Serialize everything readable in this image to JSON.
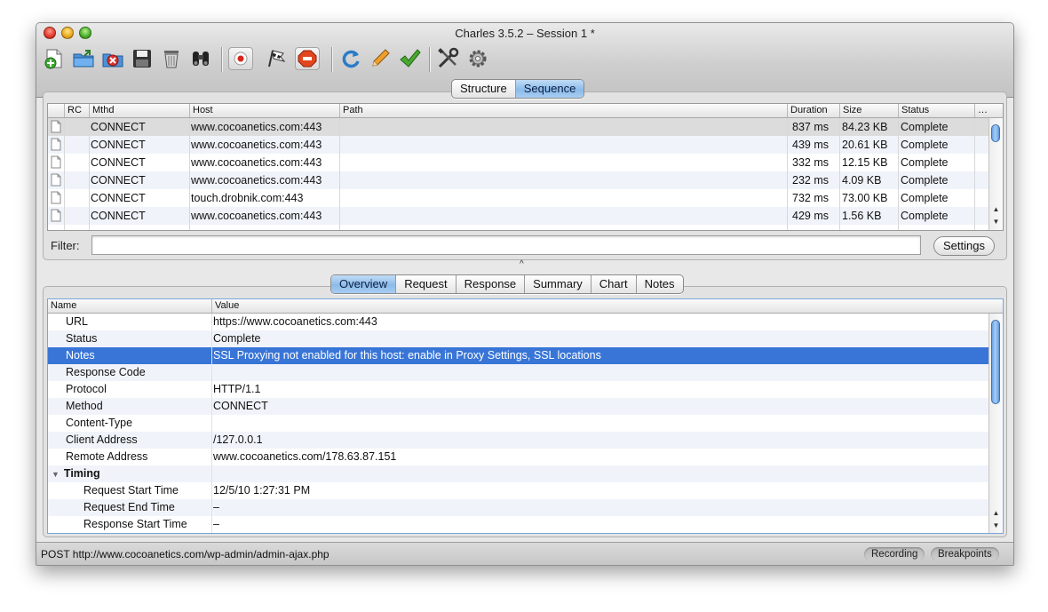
{
  "window": {
    "title": "Charles 3.5.2 – Session 1 *"
  },
  "toolbar": {
    "items": [
      {
        "name": "new-session-icon"
      },
      {
        "name": "open-session-icon"
      },
      {
        "name": "close-session-icon"
      },
      {
        "name": "save-session-icon"
      },
      {
        "name": "clear-session-icon"
      },
      {
        "name": "find-icon"
      },
      {
        "name": "record-icon"
      },
      {
        "name": "throttle-icon"
      },
      {
        "name": "breakpoints-icon"
      },
      {
        "name": "repeat-icon"
      },
      {
        "name": "edit-icon"
      },
      {
        "name": "validate-icon"
      },
      {
        "name": "tools-icon"
      },
      {
        "name": "settings-gear-icon"
      }
    ]
  },
  "view_tabs": [
    {
      "label": "Structure",
      "active": false
    },
    {
      "label": "Sequence",
      "active": true
    }
  ],
  "sequence_table": {
    "columns": [
      "RC",
      "Mthd",
      "Host",
      "Path",
      "Duration",
      "Size",
      "Status",
      "…"
    ],
    "rows": [
      {
        "method": "CONNECT",
        "host": "www.cocoanetics.com:443",
        "path": "",
        "duration": "837 ms",
        "size": "84.23 KB",
        "status": "Complete"
      },
      {
        "method": "CONNECT",
        "host": "www.cocoanetics.com:443",
        "path": "",
        "duration": "439 ms",
        "size": "20.61 KB",
        "status": "Complete"
      },
      {
        "method": "CONNECT",
        "host": "www.cocoanetics.com:443",
        "path": "",
        "duration": "332 ms",
        "size": "12.15 KB",
        "status": "Complete"
      },
      {
        "method": "CONNECT",
        "host": "www.cocoanetics.com:443",
        "path": "",
        "duration": "232 ms",
        "size": "4.09 KB",
        "status": "Complete"
      },
      {
        "method": "CONNECT",
        "host": "touch.drobnik.com:443",
        "path": "",
        "duration": "732 ms",
        "size": "73.00 KB",
        "status": "Complete"
      },
      {
        "method": "CONNECT",
        "host": "www.cocoanetics.com:443",
        "path": "",
        "duration": "429 ms",
        "size": "1.56 KB",
        "status": "Complete"
      }
    ]
  },
  "filter": {
    "label": "Filter:",
    "value": "",
    "settings_label": "Settings"
  },
  "detail_tabs": [
    {
      "label": "Overview",
      "active": true
    },
    {
      "label": "Request",
      "active": false
    },
    {
      "label": "Response",
      "active": false
    },
    {
      "label": "Summary",
      "active": false
    },
    {
      "label": "Chart",
      "active": false
    },
    {
      "label": "Notes",
      "active": false
    }
  ],
  "overview": {
    "columns": [
      "Name",
      "Value"
    ],
    "rows": [
      {
        "name": "URL",
        "value": "https://www.cocoanetics.com:443"
      },
      {
        "name": "Status",
        "value": "Complete"
      },
      {
        "name": "Notes",
        "value": "SSL Proxying not enabled for this host: enable in Proxy Settings, SSL locations"
      },
      {
        "name": "Response Code",
        "value": ""
      },
      {
        "name": "Protocol",
        "value": "HTTP/1.1"
      },
      {
        "name": "Method",
        "value": "CONNECT"
      },
      {
        "name": "Content-Type",
        "value": ""
      },
      {
        "name": "Client Address",
        "value": "/127.0.0.1"
      },
      {
        "name": "Remote Address",
        "value": "www.cocoanetics.com/178.63.87.151"
      },
      {
        "name": "Timing",
        "value": ""
      },
      {
        "name": "Request Start Time",
        "value": "12/5/10 1:27:31 PM"
      },
      {
        "name": "Request End Time",
        "value": "–"
      },
      {
        "name": "Response Start Time",
        "value": "–"
      }
    ]
  },
  "statusbar": {
    "text": "POST http://www.cocoanetics.com/wp-admin/admin-ajax.php",
    "recording_label": "Recording",
    "breakpoints_label": "Breakpoints"
  }
}
